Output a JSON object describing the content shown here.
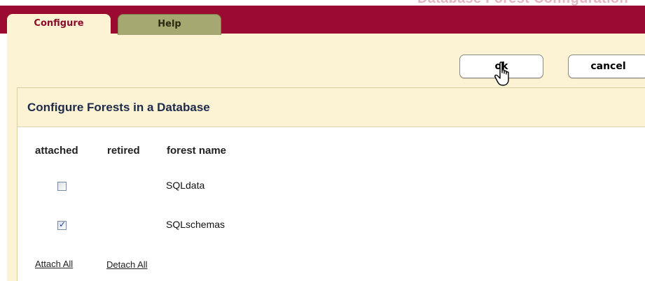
{
  "header": {
    "page_title": "Database Forest Configuration"
  },
  "tabs": [
    {
      "label": "Configure",
      "active": true
    },
    {
      "label": "Help",
      "active": false
    }
  ],
  "buttons": {
    "ok_label": "ok",
    "cancel_label": "cancel"
  },
  "section": {
    "title": "Configure Forests in a Database"
  },
  "table": {
    "columns": [
      "attached",
      "retired",
      "forest name"
    ],
    "rows": [
      {
        "attached": false,
        "forest_name": "SQLdata"
      },
      {
        "attached": true,
        "forest_name": "SQLschemas"
      }
    ]
  },
  "links": {
    "attach_all": "Attach All",
    "detach_all": "Detach All"
  },
  "colors": {
    "brand_bar": "#9b0a31",
    "panel_bg": "#fbf3d4",
    "help_tab": "#a6a872",
    "title_text": "#1e2a4a"
  }
}
